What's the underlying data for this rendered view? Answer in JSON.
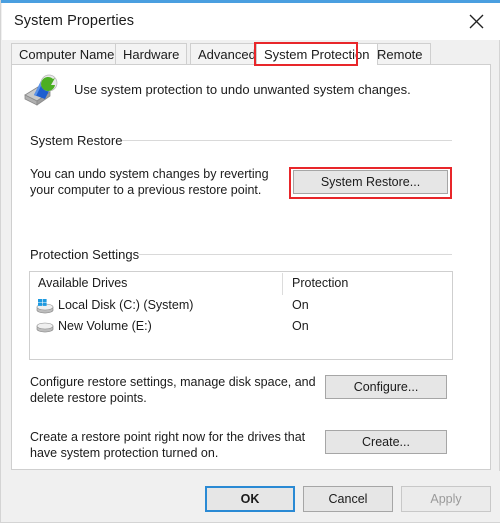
{
  "window": {
    "title": "System Properties",
    "close_icon": "close-icon",
    "accent_color": "#4a9fe0"
  },
  "tabs": [
    {
      "label": "Computer Name",
      "active": false
    },
    {
      "label": "Hardware",
      "active": false
    },
    {
      "label": "Advanced",
      "active": false
    },
    {
      "label": "System Protection",
      "active": true
    },
    {
      "label": "Remote",
      "active": false
    }
  ],
  "panel": {
    "icon": "system-protection-icon",
    "headline": "Use system protection to undo unwanted system changes."
  },
  "system_restore": {
    "group_label": "System Restore",
    "description_line1": "You can undo system changes by reverting",
    "description_line2": "your computer to a previous restore point.",
    "button_label": "System Restore..."
  },
  "protection_settings": {
    "group_label": "Protection Settings",
    "columns": [
      "Available Drives",
      "Protection"
    ],
    "drives": [
      {
        "name": "Local Disk (C:) (System)",
        "protection": "On",
        "icon": "system-drive-icon"
      },
      {
        "name": "New Volume (E:)",
        "protection": "On",
        "icon": "drive-icon"
      }
    ],
    "configure": {
      "description_line1": "Configure restore settings, manage disk space, and",
      "description_line2": "delete restore points.",
      "button_label": "Configure..."
    },
    "create": {
      "description_line1": "Create a restore point right now for the drives that",
      "description_line2": "have system protection turned on.",
      "button_label": "Create..."
    }
  },
  "footer": {
    "ok_label": "OK",
    "cancel_label": "Cancel",
    "apply_label": "Apply"
  },
  "annotations": {
    "color": "#e8262a",
    "items": [
      "system-protection-tab",
      "system-restore-button"
    ]
  }
}
